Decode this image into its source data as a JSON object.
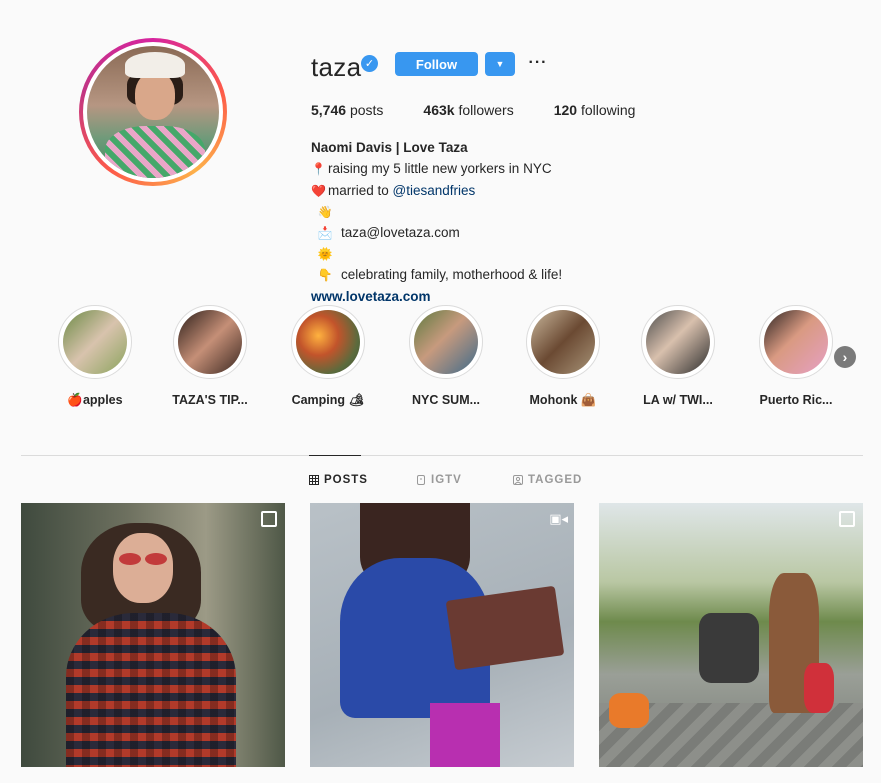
{
  "profile": {
    "username": "taza",
    "verified_icon": "✓",
    "follow_label": "Follow",
    "dropdown_icon": "▼",
    "more_icon": "···"
  },
  "stats": {
    "posts": "5,746",
    "posts_label": "posts",
    "followers": "463k",
    "followers_label": "followers",
    "following": "120",
    "following_label": "following"
  },
  "bio": {
    "name": "Naomi Davis | Love Taza",
    "line1": "raising my 5 little new yorkers in NYC",
    "line2_prefix": "married to ",
    "line2_mention": "@tiesandfries",
    "line3": "taza@lovetaza.com",
    "line4": "celebrating family, motherhood & life!",
    "link": "www.lovetaza.com",
    "emoji1": "📍",
    "emoji2": "❤️",
    "emoji3": "👋📩",
    "emoji4": "🌞👇"
  },
  "highlights": [
    {
      "label": "🍎apples"
    },
    {
      "label": "TAZA'S TIP..."
    },
    {
      "label": "Camping 🏕"
    },
    {
      "label": "NYC SUM..."
    },
    {
      "label": "Mohonk 👜"
    },
    {
      "label": "LA w/ TWI..."
    },
    {
      "label": "Puerto Ric..."
    }
  ],
  "highlights_next_icon": "›",
  "tabs": {
    "posts": "POSTS",
    "igtv": "IGTV",
    "tagged": "TAGGED"
  },
  "posts": [
    {
      "type": "carousel"
    },
    {
      "type": "video"
    },
    {
      "type": "carousel"
    }
  ],
  "colors": {
    "accent": "#3897f0",
    "link": "#003569",
    "text": "#262626",
    "muted": "#999999",
    "background": "#fafafa"
  }
}
